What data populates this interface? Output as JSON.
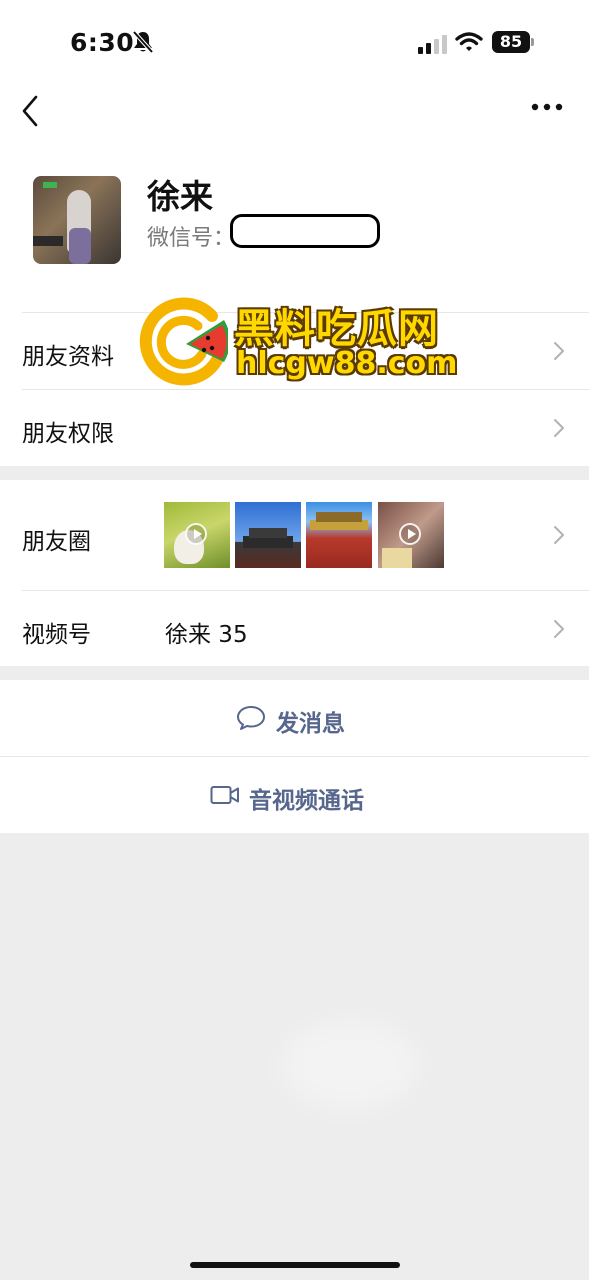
{
  "status_bar": {
    "time": "6:30",
    "battery": "85",
    "icons": [
      "bell-slash-icon",
      "signal-icon",
      "wifi-icon",
      "battery-icon"
    ]
  },
  "nav": {
    "back_icon": "chevron-left-icon",
    "more_icon": "more-dots-icon"
  },
  "profile": {
    "name": "徐来",
    "wechat_id_label": "微信号："
  },
  "watermark": {
    "text_cn": "黑料吃瓜网",
    "text_en": "hlcgw88.com"
  },
  "rows": {
    "friend_info": {
      "label": "朋友资料"
    },
    "friend_permissions": {
      "label": "朋友权限"
    },
    "moments": {
      "label": "朋友圈",
      "thumb_count": 4
    },
    "channels": {
      "label": "视频号",
      "value": "徐来 35"
    }
  },
  "actions": {
    "send_message": {
      "label": "发消息",
      "icon": "chat-bubble-icon"
    },
    "video_call": {
      "label": "音视频通话",
      "icon": "video-camera-icon"
    }
  },
  "colors": {
    "action_text": "#56668c",
    "background": "#ededed",
    "watermark_yellow": "#ffd800"
  }
}
